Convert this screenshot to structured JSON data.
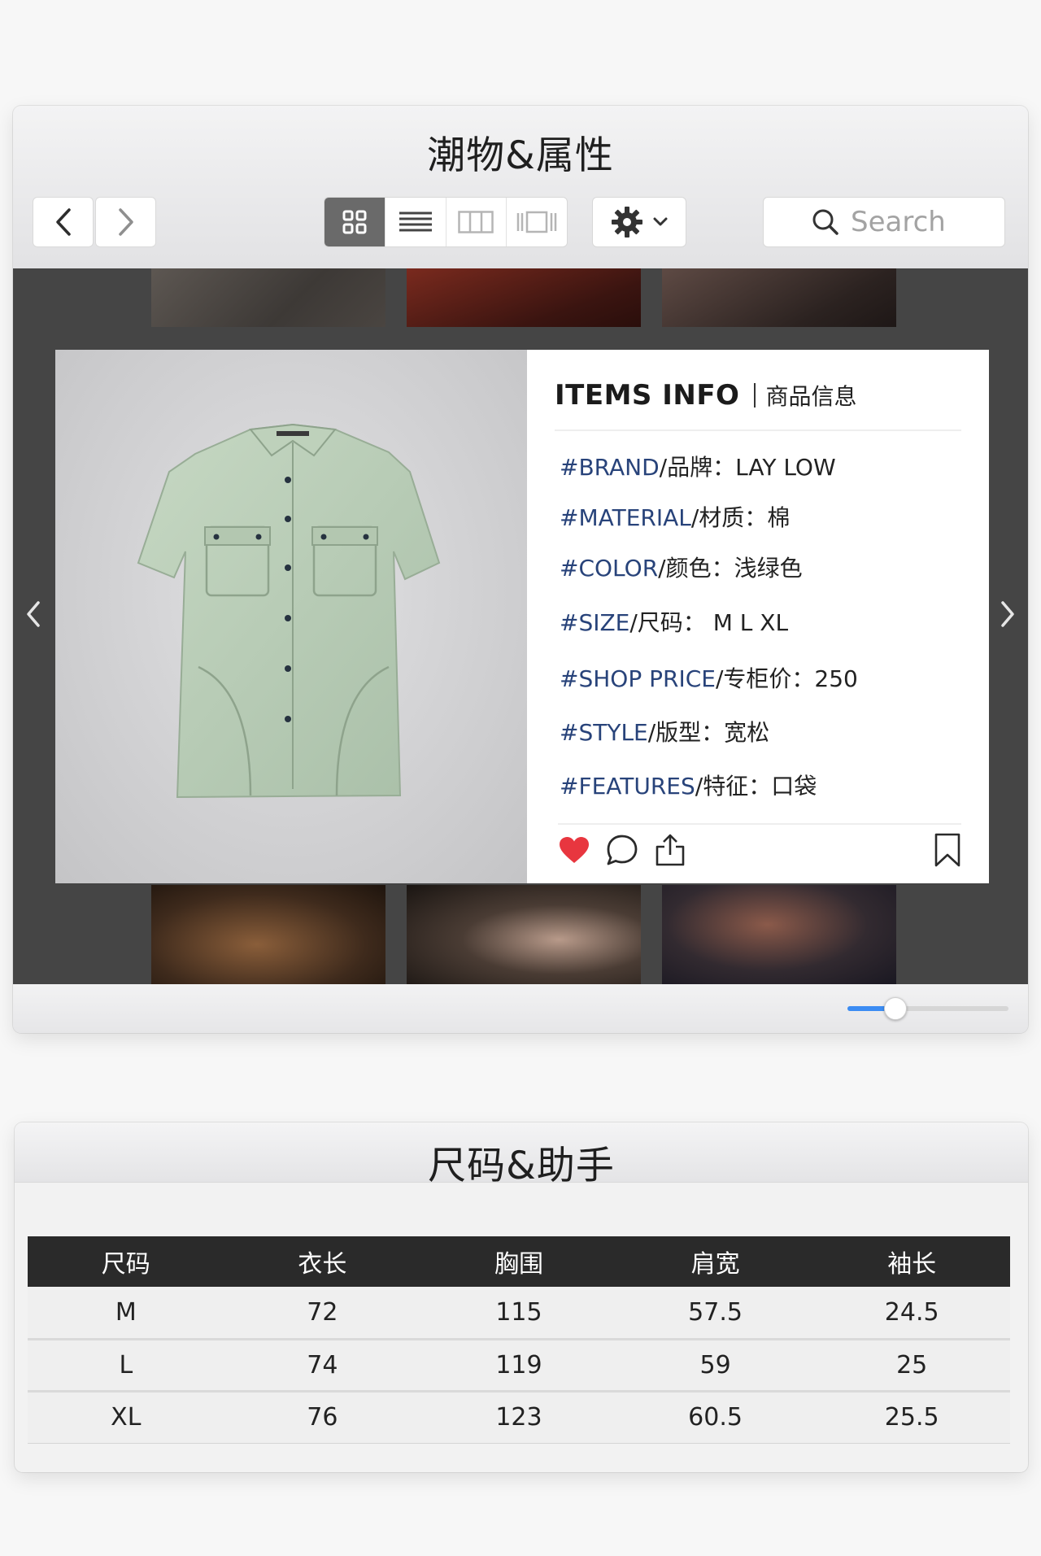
{
  "window1": {
    "title": "潮物&属性",
    "nav": {
      "back": "‹",
      "forward": "›"
    },
    "view_modes": [
      "grid",
      "list",
      "columns",
      "cover-flow"
    ],
    "active_view": "grid",
    "search": {
      "placeholder": "Search"
    },
    "slider_value": 0.3
  },
  "item_info": {
    "heading_en": "ITEMS INFO",
    "heading_zh": "商品信息",
    "attributes": [
      {
        "key": "#BRAND",
        "key_zh": "/品牌：",
        "value": "LAY LOW"
      },
      {
        "key": "#MATERIAL",
        "key_zh": "/材质：",
        "value": "棉"
      },
      {
        "key": "#COLOR",
        "key_zh": "/颜色：",
        "value": "浅绿色"
      },
      {
        "key": "#SIZE",
        "key_zh": "/尺码：",
        "value": " M L XL"
      },
      {
        "key": "#SHOP PRICE",
        "key_zh": "/专柜价：",
        "value": "250"
      },
      {
        "key": "#STYLE",
        "key_zh": "/版型：",
        "value": "宽松"
      },
      {
        "key": "#FEATURES",
        "key_zh": "/特征：",
        "value": "口袋"
      }
    ]
  },
  "window2": {
    "title": "尺码&助手",
    "table": {
      "headers": [
        "尺码",
        "衣长",
        "胸围",
        "肩宽",
        "袖长"
      ],
      "rows": [
        [
          "M",
          "72",
          "115",
          "57.5",
          "24.5"
        ],
        [
          "L",
          "74",
          "119",
          "59",
          "25"
        ],
        [
          "XL",
          "76",
          "123",
          "60.5",
          "25.5"
        ]
      ]
    }
  },
  "colors": {
    "accent_blue": "#3b8cf3",
    "key_blue": "#28437a",
    "heart_red": "#e8363f",
    "table_header": "#2a2a2a",
    "shirt": "#b9cdb7"
  }
}
